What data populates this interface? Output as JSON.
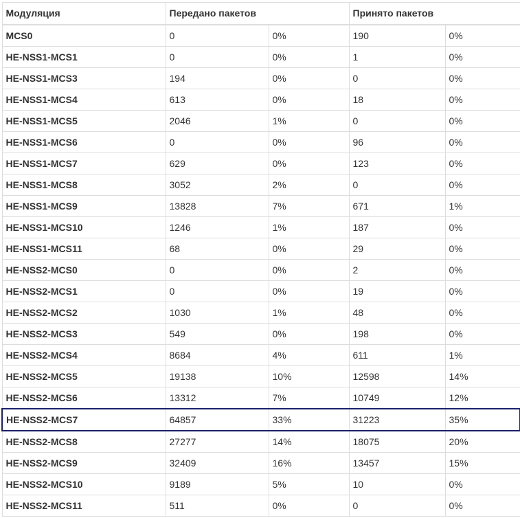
{
  "table": {
    "headers": {
      "modulation": "Модуляция",
      "transmitted": "Передано пакетов",
      "received": "Принято пакетов"
    },
    "highlight_color": "#1a1f6b",
    "highlighted_row": "HE-NSS2-MCS7",
    "rows": [
      {
        "mod": "MCS0",
        "tx": "0",
        "tx_pct": "0%",
        "rx": "190",
        "rx_pct": "0%"
      },
      {
        "mod": "HE-NSS1-MCS1",
        "tx": "0",
        "tx_pct": "0%",
        "rx": "1",
        "rx_pct": "0%"
      },
      {
        "mod": "HE-NSS1-MCS3",
        "tx": "194",
        "tx_pct": "0%",
        "rx": "0",
        "rx_pct": "0%"
      },
      {
        "mod": "HE-NSS1-MCS4",
        "tx": "613",
        "tx_pct": "0%",
        "rx": "18",
        "rx_pct": "0%"
      },
      {
        "mod": "HE-NSS1-MCS5",
        "tx": "2046",
        "tx_pct": "1%",
        "rx": "0",
        "rx_pct": "0%"
      },
      {
        "mod": "HE-NSS1-MCS6",
        "tx": "0",
        "tx_pct": "0%",
        "rx": "96",
        "rx_pct": "0%"
      },
      {
        "mod": "HE-NSS1-MCS7",
        "tx": "629",
        "tx_pct": "0%",
        "rx": "123",
        "rx_pct": "0%"
      },
      {
        "mod": "HE-NSS1-MCS8",
        "tx": "3052",
        "tx_pct": "2%",
        "rx": "0",
        "rx_pct": "0%"
      },
      {
        "mod": "HE-NSS1-MCS9",
        "tx": "13828",
        "tx_pct": "7%",
        "rx": "671",
        "rx_pct": "1%"
      },
      {
        "mod": "HE-NSS1-MCS10",
        "tx": "1246",
        "tx_pct": "1%",
        "rx": "187",
        "rx_pct": "0%"
      },
      {
        "mod": "HE-NSS1-MCS11",
        "tx": "68",
        "tx_pct": "0%",
        "rx": "29",
        "rx_pct": "0%"
      },
      {
        "mod": "HE-NSS2-MCS0",
        "tx": "0",
        "tx_pct": "0%",
        "rx": "2",
        "rx_pct": "0%"
      },
      {
        "mod": "HE-NSS2-MCS1",
        "tx": "0",
        "tx_pct": "0%",
        "rx": "19",
        "rx_pct": "0%"
      },
      {
        "mod": "HE-NSS2-MCS2",
        "tx": "1030",
        "tx_pct": "1%",
        "rx": "48",
        "rx_pct": "0%"
      },
      {
        "mod": "HE-NSS2-MCS3",
        "tx": "549",
        "tx_pct": "0%",
        "rx": "198",
        "rx_pct": "0%"
      },
      {
        "mod": "HE-NSS2-MCS4",
        "tx": "8684",
        "tx_pct": "4%",
        "rx": "611",
        "rx_pct": "1%"
      },
      {
        "mod": "HE-NSS2-MCS5",
        "tx": "19138",
        "tx_pct": "10%",
        "rx": "12598",
        "rx_pct": "14%"
      },
      {
        "mod": "HE-NSS2-MCS6",
        "tx": "13312",
        "tx_pct": "7%",
        "rx": "10749",
        "rx_pct": "12%"
      },
      {
        "mod": "HE-NSS2-MCS7",
        "tx": "64857",
        "tx_pct": "33%",
        "rx": "31223",
        "rx_pct": "35%"
      },
      {
        "mod": "HE-NSS2-MCS8",
        "tx": "27277",
        "tx_pct": "14%",
        "rx": "18075",
        "rx_pct": "20%"
      },
      {
        "mod": "HE-NSS2-MCS9",
        "tx": "32409",
        "tx_pct": "16%",
        "rx": "13457",
        "rx_pct": "15%"
      },
      {
        "mod": "HE-NSS2-MCS10",
        "tx": "9189",
        "tx_pct": "5%",
        "rx": "10",
        "rx_pct": "0%"
      },
      {
        "mod": "HE-NSS2-MCS11",
        "tx": "511",
        "tx_pct": "0%",
        "rx": "0",
        "rx_pct": "0%"
      }
    ]
  }
}
